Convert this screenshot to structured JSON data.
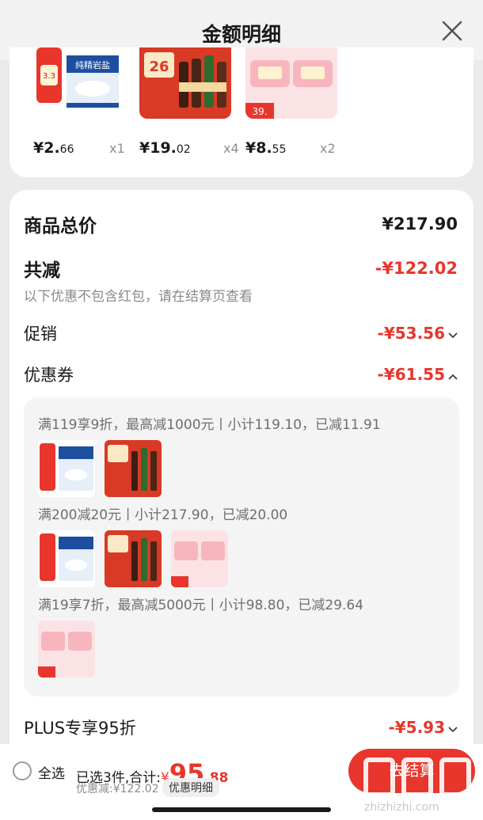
{
  "header": {
    "title": "金额明细"
  },
  "products": [
    {
      "price_main": "¥2.",
      "price_dec": "66",
      "qty": "x1"
    },
    {
      "price_main": "¥19.",
      "price_dec": "02",
      "qty": "x4"
    },
    {
      "price_main": "¥8.",
      "price_dec": "55",
      "qty": "x2"
    }
  ],
  "product_labels": {
    "salt": "纯精岩盐",
    "badge_33": "3.3",
    "badge_26": "26",
    "badge_39": "39."
  },
  "detail": {
    "total_label": "商品总价",
    "total_value": "¥217.90",
    "reduce_label": "共减",
    "reduce_value": "-¥122.02",
    "note": "以下优惠不包含红包，请在结算页查看",
    "promo_label": "促销",
    "promo_value": "-¥53.56",
    "coupon_label": "优惠券",
    "coupon_value": "-¥61.55",
    "plus_label": "PLUS专享95折",
    "plus_value": "-¥5.93"
  },
  "coupon_rules": [
    "满119享9折，最高减1000元丨小计119.10，已减11.91",
    "满200减20元丨小计217.90，已减20.00",
    "满19享7折，最高减5000元丨小计98.80，已减29.64"
  ],
  "bottom": {
    "select_all": "全选",
    "selected": "已选3件,合计:",
    "currency": "¥",
    "total_int": "95",
    "total_dec": ".88",
    "reduced": "优惠减:¥122.02",
    "detail_btn": "优惠明细",
    "checkout": "去结算"
  },
  "watermark": {
    "text": "zhizhizhi.com"
  },
  "colors": {
    "accent": "#e8362c",
    "panel": "#ffffff",
    "background": "#ecebeb"
  }
}
